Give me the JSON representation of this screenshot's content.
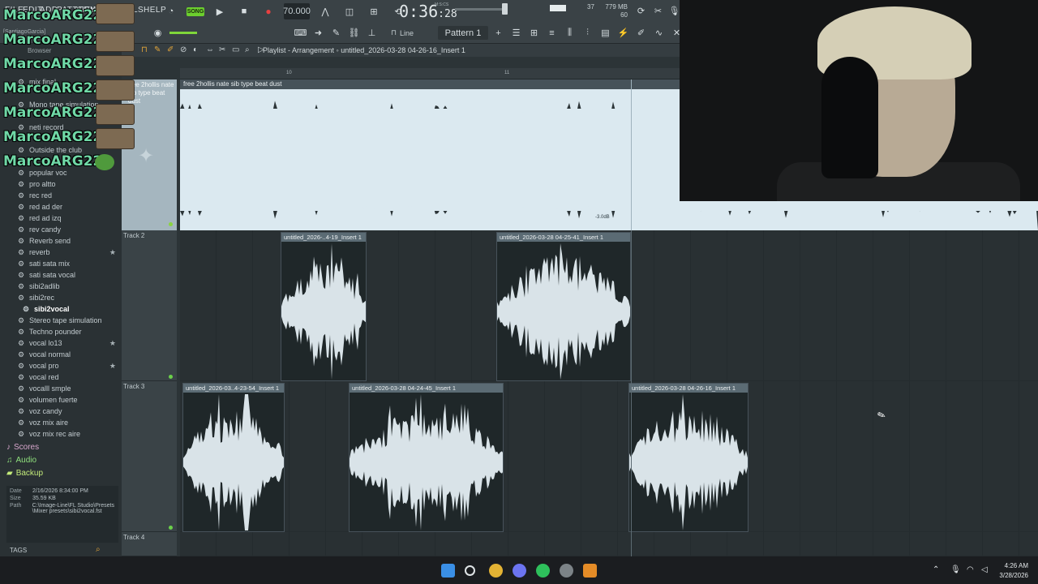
{
  "toolbar": {
    "menu": [
      "FILE",
      "EDIT",
      "ADD",
      "PATTERNS",
      "VIEW",
      "LS",
      "HELP"
    ],
    "mode_label": "SONG",
    "tempo": "70.000",
    "time": "0:36",
    "time_small": ":28",
    "time_unit": "M:S:CS",
    "cpu": "37",
    "memory": "779 MB",
    "polyphony": "60",
    "snap": "Line",
    "pattern": "Pattern 1"
  },
  "chat": {
    "user": "MarcoARG22:",
    "lines": 7
  },
  "browser": {
    "user_tag": "[SantiagoGarcia]",
    "header": "Browser",
    "items": [
      {
        "label": "mix final",
        "star": false
      },
      {
        "label": "Mono tape simulation",
        "star": false
      },
      {
        "label": "neti record",
        "star": false
      },
      {
        "label": "Outside the club",
        "star": false
      },
      {
        "label": "popular voc",
        "star": false
      },
      {
        "label": "pro altto",
        "star": false
      },
      {
        "label": "rec red",
        "star": false
      },
      {
        "label": "red ad der",
        "star": false
      },
      {
        "label": "red ad izq",
        "star": false
      },
      {
        "label": "rev candy",
        "star": false
      },
      {
        "label": "Reverb send",
        "star": false
      },
      {
        "label": "reverb",
        "star": true
      },
      {
        "label": "sati sata mix",
        "star": false
      },
      {
        "label": "sati sata vocal",
        "star": false
      },
      {
        "label": "sibi2adlib",
        "star": false
      },
      {
        "label": "sibi2rec",
        "star": false
      },
      {
        "label": "sibi2vocal",
        "star": false,
        "selected": true
      },
      {
        "label": "Stereo tape simulation",
        "star": false
      },
      {
        "label": "Techno pounder",
        "star": false
      },
      {
        "label": "vocal lo13",
        "star": true
      },
      {
        "label": "vocal normal",
        "star": false
      },
      {
        "label": "vocal pro",
        "star": true
      },
      {
        "label": "vocal red",
        "star": false
      },
      {
        "label": "vocalll smple",
        "star": false
      },
      {
        "label": "volumen fuerte",
        "star": false
      },
      {
        "label": "voz candy",
        "star": false
      },
      {
        "label": "voz mix aire",
        "star": false
      },
      {
        "label": "voz mix rec aire",
        "star": false
      }
    ],
    "folders": [
      "Scores",
      "Audio",
      "Backup"
    ],
    "info": {
      "date_label": "Date",
      "date": "2/16/2026 8:34:00 PM",
      "size_label": "Size",
      "size": "35.59 KB",
      "path_label": "Path",
      "path": "C:\\Image-Line\\FL Studio\\Presets\\Mixer presets\\sibi2vocal.fst"
    },
    "tags_label": "TAGS"
  },
  "playlist": {
    "title": "Playlist - Arrangement",
    "arrangement_file": "untitled_2026-03-28 04-26-16_Insert 1",
    "ruler_ticks": [
      "10",
      "11"
    ],
    "beat_track_title": "free 2hollis  nate sib type beat dust",
    "beat_header": "free 2hollis nate sib type beat dust",
    "beat_db": "-3.0dB",
    "tracks": [
      {
        "label": "Track 2",
        "clips": [
          {
            "title": "untitled_2026-..4-19_Insert 1"
          },
          {
            "title": "untitled_2026-03-28 04-25-41_Insert 1"
          }
        ]
      },
      {
        "label": "Track 3",
        "clips": [
          {
            "title": "untitled_2026-03..4-23-54_Insert 1"
          },
          {
            "title": "untitled_2026-03-28 04-24-45_Insert 1"
          },
          {
            "title": "untitled_2026-03-28 04-26-16_Insert 1"
          }
        ]
      },
      {
        "label": "Track 4",
        "clips": []
      }
    ]
  },
  "taskbar": {
    "time": "4:26 AM",
    "date": "3/28/2026"
  }
}
